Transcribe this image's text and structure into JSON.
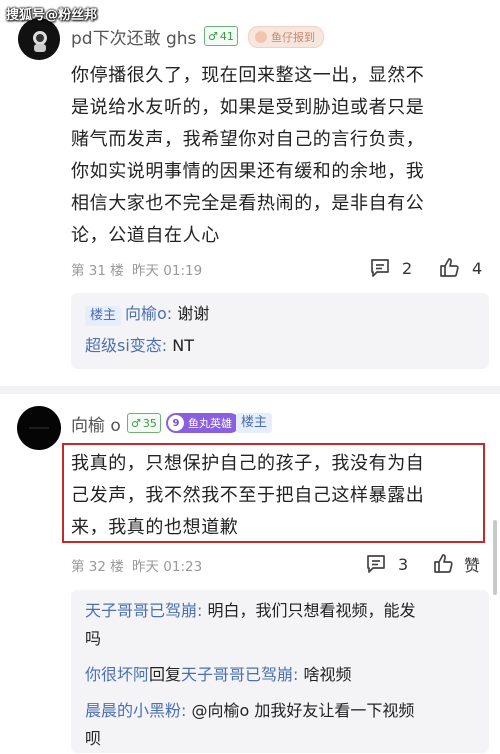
{
  "watermark": "搜狐号@粉丝邦",
  "comment1": {
    "username": "pd下次还敢 ghs",
    "level": "41",
    "badge": "鱼仔报到",
    "text_lines": [
      "你停播很久了，现在回来整这一出，显然不",
      "是说给水友听的，如果是受到胁迫或者只是",
      "赌气而发声，我希望你对自己的言行负责，",
      "你如实说明事情的因果还有缓和的余地，我",
      "相信大家也不完全是看热闹的，是非自有公",
      "论，公道自在人心"
    ],
    "floor": "第 31 楼",
    "time": "昨天 01:19",
    "reply_count": "2",
    "like_count": "4",
    "replies": [
      {
        "tag": "楼主",
        "name": "向榆o:",
        "text": "谢谢"
      },
      {
        "name": "超级si变态:",
        "text": "NT"
      }
    ]
  },
  "comment2": {
    "username": "向榆 o",
    "level": "35",
    "badge_level": "9",
    "badge": "鱼丸英雄",
    "owner_tag": "楼主",
    "text_lines": [
      "我真的，只想保护自己的孩子，我没有为自",
      "己发声，我不然我不至于把自己这样暴露出",
      "来，我真的也想道歉"
    ],
    "floor": "第 32 楼",
    "time": "昨天 01:23",
    "reply_count": "3",
    "like_label": "赞",
    "replies": [
      {
        "name": "天子哥哥已驾崩:",
        "text": "明白，我们只想看视频，能发",
        "cont": "吗"
      },
      {
        "name": "你很坏阿",
        "mid": "回复",
        "target": "天子哥哥已驾崩:",
        "text": "啥视频"
      },
      {
        "name": "晨晨的小黑粉:",
        "text": "@向榆o 加我好友让看一下视频",
        "cont": "呗"
      }
    ]
  },
  "colors": {
    "link_blue": "#4a6fb5",
    "highlight_red": "#c6282c",
    "level_green": "#3a9a48",
    "badge_purple": "#7b4fd0"
  }
}
